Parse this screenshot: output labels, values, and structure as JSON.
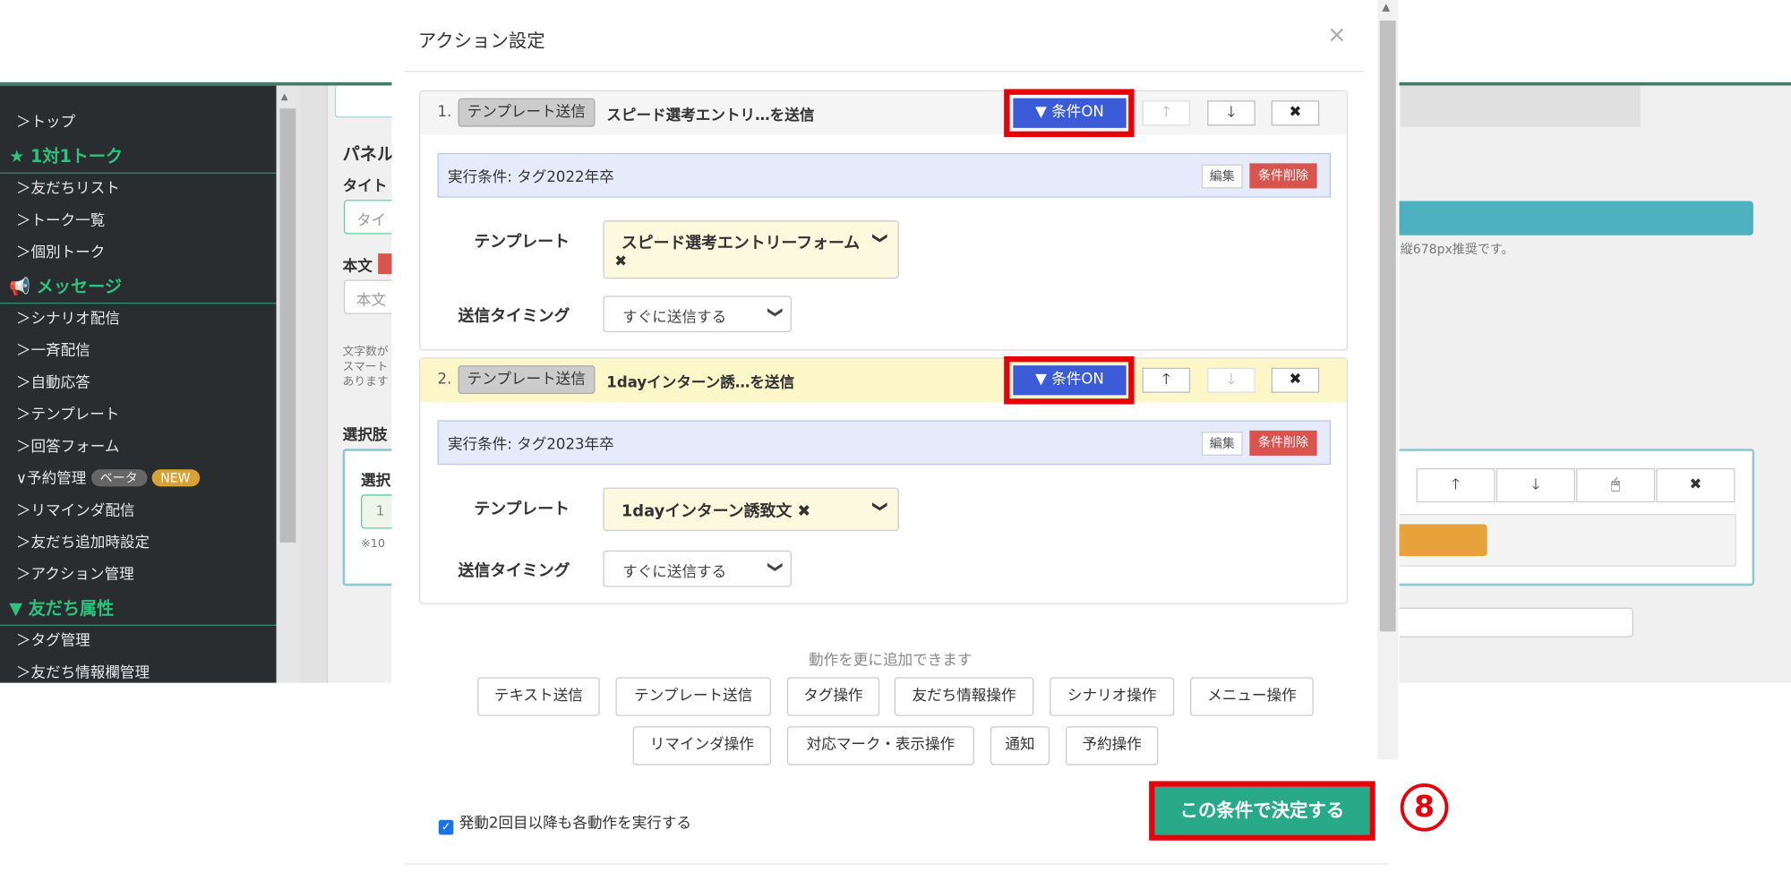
{
  "sidebar": {
    "items": [
      {
        "type": "item",
        "label": "＞トップ"
      },
      {
        "type": "head",
        "icon": "star-icon",
        "label": "★ 1対1トーク"
      },
      {
        "type": "item",
        "label": "＞友だちリスト"
      },
      {
        "type": "item",
        "label": "＞トーク一覧"
      },
      {
        "type": "item",
        "label": "＞個別トーク"
      },
      {
        "type": "head",
        "icon": "megaphone-icon",
        "label": "📢 メッセージ"
      },
      {
        "type": "item",
        "label": "＞シナリオ配信"
      },
      {
        "type": "item",
        "label": "＞一斉配信"
      },
      {
        "type": "item",
        "label": "＞自動応答"
      },
      {
        "type": "item",
        "label": "＞テンプレート"
      },
      {
        "type": "item",
        "label": "＞回答フォーム"
      },
      {
        "type": "item",
        "label": "∨予約管理",
        "badges": [
          "ベータ",
          "NEW"
        ]
      },
      {
        "type": "item",
        "label": "＞リマインダ配信"
      },
      {
        "type": "item",
        "label": "＞友だち追加時設定"
      },
      {
        "type": "item",
        "label": "＞アクション管理"
      },
      {
        "type": "head",
        "icon": "filter-icon",
        "label": "▼ 友だち属性"
      },
      {
        "type": "item",
        "label": "＞タグ管理"
      },
      {
        "type": "item",
        "label": "＞友だち情報欄管理"
      }
    ]
  },
  "background": {
    "panel_label": "パネル",
    "title_label": "タイト",
    "title_placeholder": "タイ",
    "body_label": "本文",
    "body_placeholder": "本文",
    "note_lines": "文字数が\nスマート\nあります",
    "choice_label": "選択肢",
    "choice_inner": "選択",
    "choice_num": "1",
    "choice_note": "※10",
    "image_note": "縦678px推奨です。",
    "row_buttons": [
      "🡑",
      "🡓",
      "🖱",
      "✖"
    ]
  },
  "modal": {
    "title": "アクション設定",
    "close": "×",
    "actions": [
      {
        "num": "1.",
        "type_tag": "テンプレート送信",
        "label": "スピード選考エントリ…を送信",
        "cond_button": "▼ 条件ON",
        "up": "🡑",
        "down": "🡓",
        "remove": "✖",
        "condition": "実行条件: タグ2022年卒",
        "edit": "編集",
        "delete_cond": "条件削除",
        "template_label": "テンプレート",
        "template_value": "スピード選考エントリーフォーム",
        "template_remove": "✖",
        "timing_label": "送信タイミング",
        "timing_value": "すぐに送信する"
      },
      {
        "num": "2.",
        "type_tag": "テンプレート送信",
        "label": "1dayインターン誘…を送信",
        "cond_button": "▼ 条件ON",
        "up": "🡑",
        "down": "🡓",
        "remove": "✖",
        "condition": "実行条件: タグ2023年卒",
        "edit": "編集",
        "delete_cond": "条件削除",
        "template_label": "テンプレート",
        "template_value": "1dayインターン誘致文 ✖",
        "timing_label": "送信タイミング",
        "timing_value": "すぐに送信する"
      }
    ],
    "more_text": "動作を更に追加できます",
    "add_buttons_row1": [
      "テキスト送信",
      "テンプレート送信",
      "タグ操作",
      "友だち情報操作",
      "シナリオ操作",
      "メニュー操作"
    ],
    "add_buttons_row2": [
      "リマインダ操作",
      "対応マーク・表示操作",
      "通知",
      "予約操作"
    ],
    "repeat_check": "発動2回目以降も各動作を実行する",
    "submit": "この条件で決定する",
    "step_marker": "8"
  },
  "colors": {
    "accent_blue": "#3b5bd9",
    "highlight_red": "#e5000a",
    "submit_green": "#27a98a",
    "sidebar_green": "#2ec27e"
  }
}
